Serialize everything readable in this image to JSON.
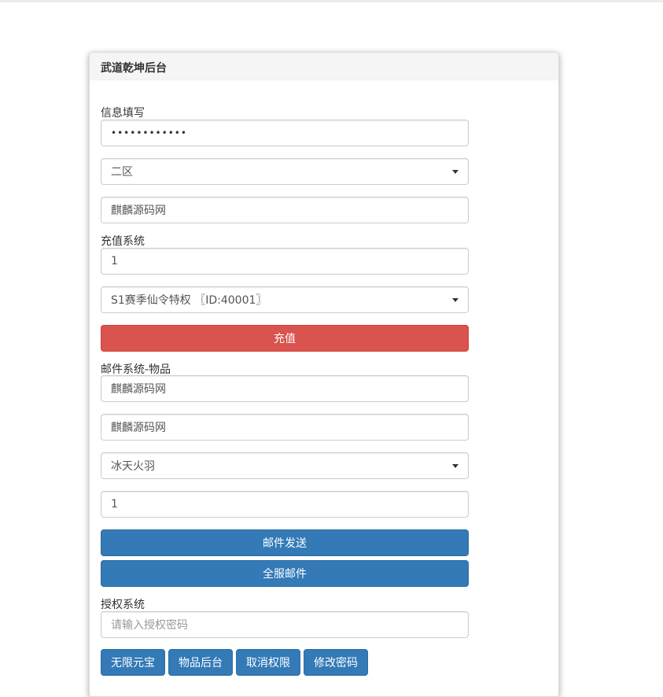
{
  "panel": {
    "title": "武道乾坤后台"
  },
  "info_section": {
    "label": "信息填写",
    "password_value": "••••••••••••",
    "server_select": "二区",
    "role_input": "麒麟源码网"
  },
  "recharge_section": {
    "label": "充值系统",
    "amount_input": "1",
    "package_select": "S1赛季仙令特权 〖ID:40001〗",
    "recharge_button": "充值"
  },
  "mail_section": {
    "label": "邮件系统-物品",
    "recipient_input": "麒麟源码网",
    "title_input": "麒麟源码网",
    "item_select": "冰天火羽",
    "quantity_input": "1",
    "send_button": "邮件发送",
    "global_mail_button": "全服邮件"
  },
  "auth_section": {
    "label": "授权系统",
    "password_placeholder": "请输入授权密码",
    "buttons": [
      "无限元宝",
      "物品后台",
      "取消权限",
      "修改密码"
    ]
  },
  "colors": {
    "danger": "#d9534f",
    "primary": "#337ab7"
  }
}
